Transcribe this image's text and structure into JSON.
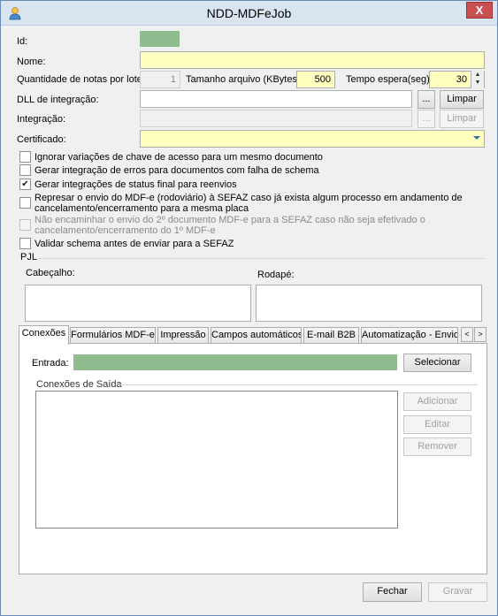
{
  "window": {
    "title": "NDD-MDFeJob",
    "close_label": "X"
  },
  "labels": {
    "id": "Id:",
    "nome": "Nome:",
    "qtd_notas": "Quantidade de notas por lote:",
    "tamanho": "Tamanho arquivo (KBytes):",
    "tempo": "Tempo espera(seg):",
    "dll": "DLL de integração:",
    "integracao": "Integração:",
    "certificado": "Certificado:"
  },
  "fields": {
    "id": "",
    "nome": "",
    "qtd_notas": "1",
    "tamanho": "500",
    "tempo": "30",
    "dll": "",
    "integracao": "",
    "certificado": ""
  },
  "buttons": {
    "browse": "...",
    "limpar": "Limpar",
    "selecionar": "Selecionar",
    "adicionar": "Adicionar",
    "editar": "Editar",
    "remover": "Remover",
    "fechar": "Fechar",
    "gravar": "Gravar"
  },
  "checkboxes": [
    {
      "label": "Ignorar variações de chave de acesso para um mesmo documento",
      "checked": false,
      "enabled": true
    },
    {
      "label": "Gerar integração de erros para documentos com falha de schema",
      "checked": false,
      "enabled": true
    },
    {
      "label": "Gerar integrações de status final para reenvios",
      "checked": true,
      "enabled": true
    },
    {
      "label": "Represar o envio do MDF-e (rodoviário) à SEFAZ caso já exista algum processo em andamento de cancelamento/encerramento para a mesma placa",
      "checked": false,
      "enabled": true
    },
    {
      "label": "Não encaminhar o envio do 2º documento MDF-e para a SEFAZ caso não seja efetivado o cancelamento/encerramento do 1º MDF-e",
      "checked": false,
      "enabled": false
    },
    {
      "label": "Validar schema antes de enviar para a SEFAZ",
      "checked": false,
      "enabled": true
    }
  ],
  "pjl": {
    "group_label": "PJL",
    "cabecalho_label": "Cabeçalho:",
    "rodape_label": "Rodapé:"
  },
  "tabs": [
    {
      "label": "Conexões",
      "active": true
    },
    {
      "label": "Formulários MDF-e",
      "active": false
    },
    {
      "label": "Impressão",
      "active": false
    },
    {
      "label": "Campos automáticos",
      "active": false
    },
    {
      "label": "E-mail B2B",
      "active": false
    },
    {
      "label": "Automatização - Envio",
      "active": false
    }
  ],
  "tab_scroll": {
    "left": "<",
    "right": ">"
  },
  "conexoes": {
    "entrada_label": "Entrada:",
    "saida_group_label": "Conexões de Saída"
  },
  "colors": {
    "required_field": "#ffffc0",
    "readonly_green": "#8fbc8f",
    "title_bar": "#d9e4f1",
    "close_button": "#c75050"
  }
}
